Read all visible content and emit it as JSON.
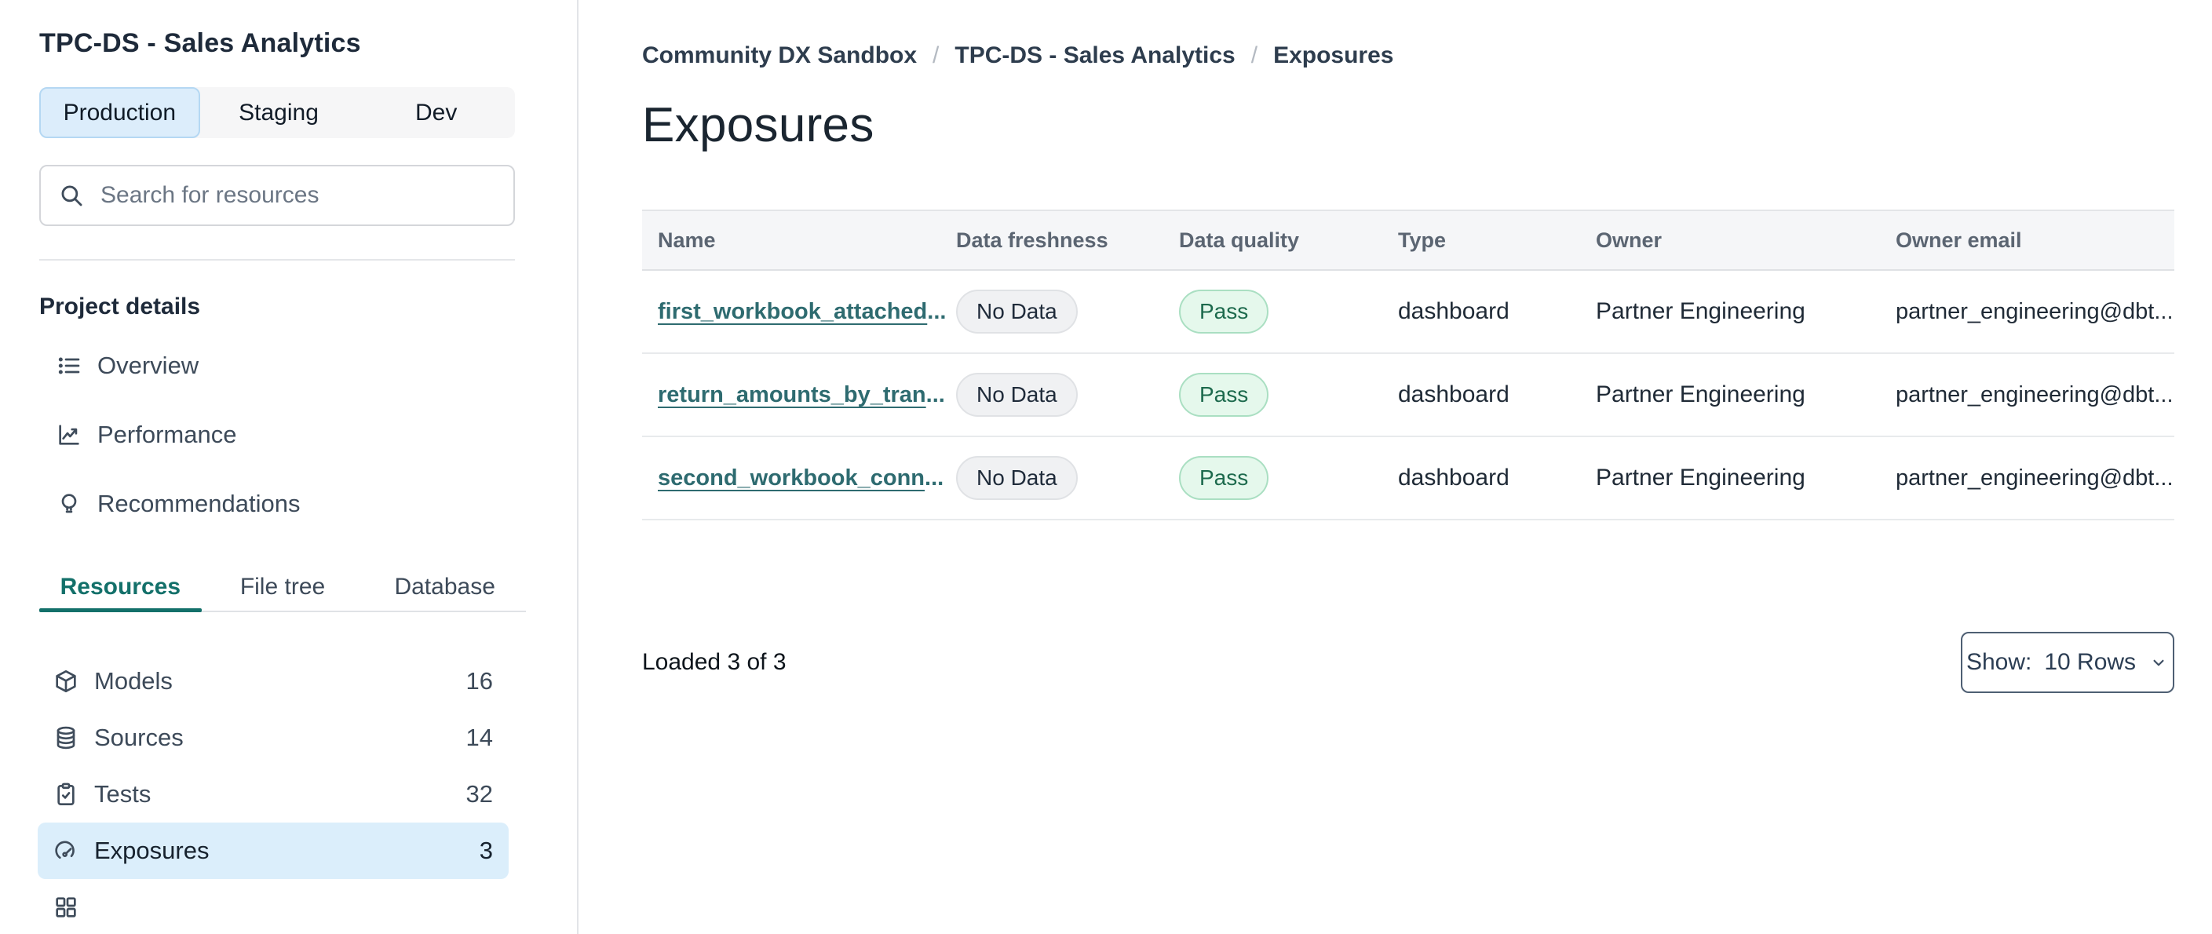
{
  "sidebar": {
    "title": "TPC-DS - Sales Analytics",
    "environment_tabs": [
      {
        "label": "Production",
        "active": true
      },
      {
        "label": "Staging",
        "active": false
      },
      {
        "label": "Dev",
        "active": false
      }
    ],
    "search_placeholder": "Search for resources",
    "section_label": "Project details",
    "project_nav": [
      {
        "icon": "list-icon",
        "label": "Overview"
      },
      {
        "icon": "line-chart-icon",
        "label": "Performance"
      },
      {
        "icon": "lightbulb-icon",
        "label": "Recommendations"
      }
    ],
    "resource_tabs": [
      {
        "label": "Resources",
        "active": true
      },
      {
        "label": "File tree",
        "active": false
      },
      {
        "label": "Database",
        "active": false
      }
    ],
    "resources": [
      {
        "icon": "cube-icon",
        "label": "Models",
        "count": "16",
        "selected": false
      },
      {
        "icon": "database-icon",
        "label": "Sources",
        "count": "14",
        "selected": false
      },
      {
        "icon": "clipboard-check-icon",
        "label": "Tests",
        "count": "32",
        "selected": false
      },
      {
        "icon": "gauge-icon",
        "label": "Exposures",
        "count": "3",
        "selected": true
      }
    ]
  },
  "breadcrumb": {
    "separator": "/",
    "items": [
      "Community DX Sandbox",
      "TPC-DS - Sales Analytics",
      "Exposures"
    ]
  },
  "page_title": "Exposures",
  "table": {
    "columns": [
      "Name",
      "Data freshness",
      "Data quality",
      "Type",
      "Owner",
      "Owner email"
    ],
    "ellipsis": "...",
    "rows": [
      {
        "name": "first_workbook_attached",
        "freshness": "No Data",
        "quality": "Pass",
        "type": "dashboard",
        "owner": "Partner Engineering",
        "owner_email": "partner_engineering@dbt"
      },
      {
        "name": "return_amounts_by_tran",
        "freshness": "No Data",
        "quality": "Pass",
        "type": "dashboard",
        "owner": "Partner Engineering",
        "owner_email": "partner_engineering@dbt"
      },
      {
        "name": "second_workbook_conn",
        "freshness": "No Data",
        "quality": "Pass",
        "type": "dashboard",
        "owner": "Partner Engineering",
        "owner_email": "partner_engineering@dbt"
      }
    ]
  },
  "footer": {
    "loaded_text": "Loaded 3 of 3",
    "show_label": "Show:",
    "show_value": "10 Rows"
  },
  "colors": {
    "accent_teal": "#13706a",
    "link_teal": "#2e6b70",
    "selected_item_blue": "#dbeefb",
    "env_tab_active_blue": "#dcedfb",
    "env_tab_border_blue": "#b5d8f3",
    "pass_bg": "#e5f8ec",
    "pass_border": "#aadfc2",
    "pass_text": "#1d6a4d",
    "nodata_bg": "#f0f1f3",
    "nodata_border": "#e0e2e5",
    "nodata_text": "#1f2b3a"
  }
}
